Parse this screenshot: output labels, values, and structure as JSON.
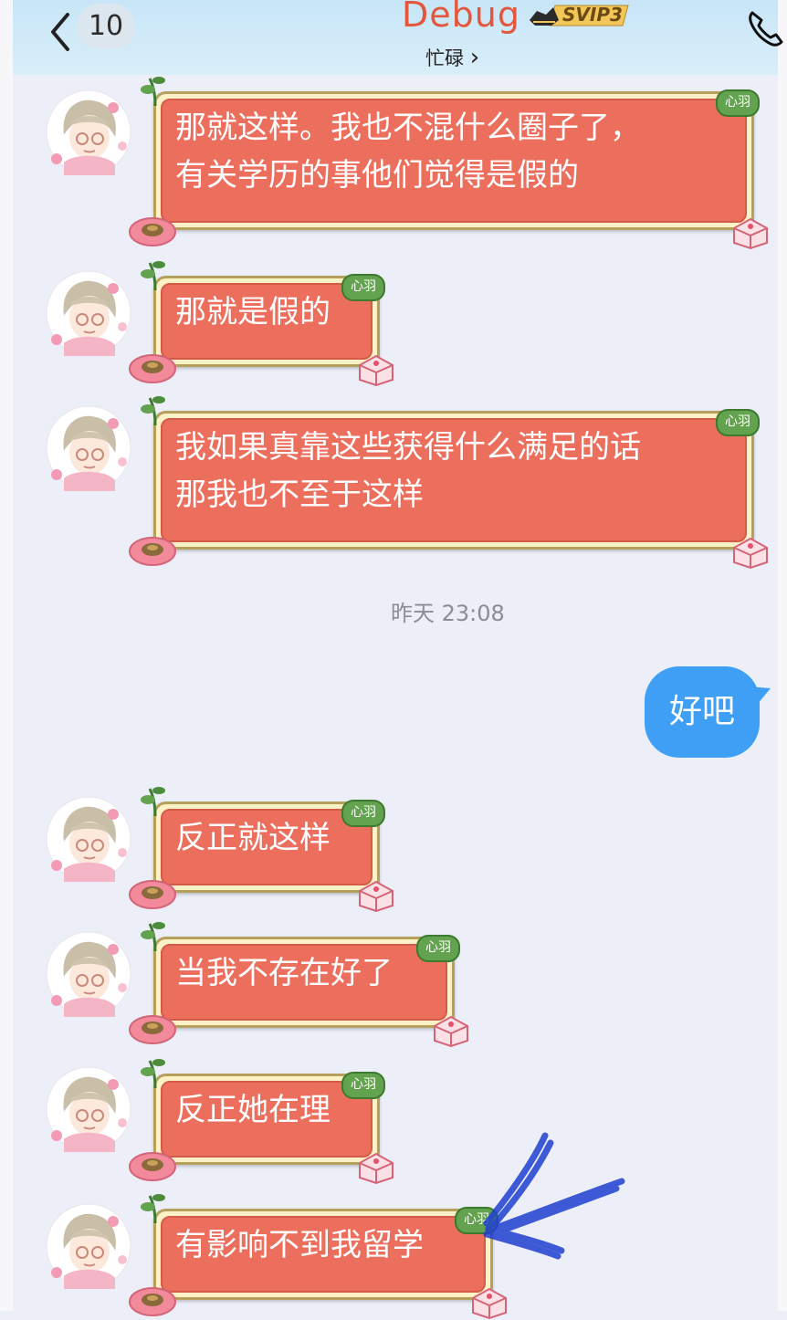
{
  "header": {
    "unread_count": "10",
    "title": "Debug",
    "vip_badge": "SVIP3",
    "status": "忙碌",
    "status_chevron": "›"
  },
  "icons": {
    "back": "chevron-left-icon",
    "call": "phone-icon",
    "status_arrow": "chevron-right-icon"
  },
  "bubble_tag": "心羽",
  "messages": [
    {
      "side": "incoming",
      "text": "那就这样。我也不混什么圈子了，\n有关学历的事他们觉得是假的"
    },
    {
      "side": "incoming",
      "text": "那就是假的"
    },
    {
      "side": "incoming",
      "text": "我如果真靠这些获得什么满足的话\n那我也不至于这样"
    },
    {
      "side": "timestamp",
      "text": "昨天 23:08"
    },
    {
      "side": "outgoing",
      "text": "好吧"
    },
    {
      "side": "incoming",
      "text": "反正就这样"
    },
    {
      "side": "incoming",
      "text": "当我不存在好了"
    },
    {
      "side": "incoming",
      "text": "反正她在理"
    },
    {
      "side": "incoming",
      "text": "有影响不到我留学"
    }
  ],
  "colors": {
    "title": "#e4573d",
    "bubble_fill": "#ec6f5e",
    "bubble_frame": "#fdf1c8",
    "outgoing_bubble": "#3e9ff5",
    "header_bg": "#c8e6f7",
    "chat_bg": "#eceff8",
    "scribble": "#1f3fd0"
  }
}
